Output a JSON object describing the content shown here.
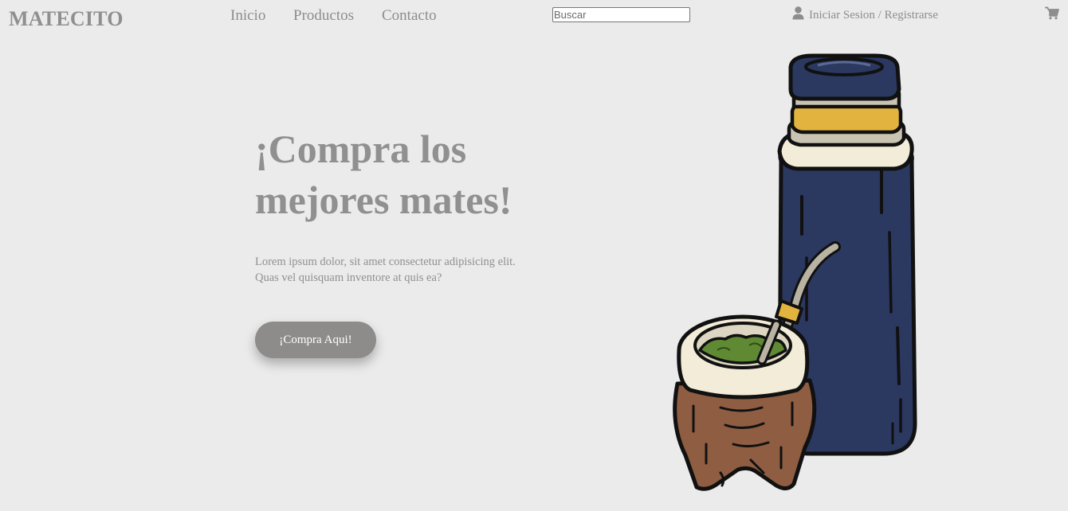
{
  "header": {
    "logo": "MATECITO",
    "nav": [
      {
        "label": "Inicio"
      },
      {
        "label": "Productos"
      },
      {
        "label": "Contacto"
      }
    ],
    "search": {
      "placeholder": "Buscar",
      "value": ""
    },
    "login": {
      "icon": "user-icon",
      "label": "Iniciar Sesion / Registrarse"
    },
    "cart": {
      "icon": "cart-icon"
    }
  },
  "hero": {
    "title_line1": "¡Compra los",
    "title_line2": "mejores mates!",
    "text_line1": "Lorem ipsum dolor, sit amet consectetur adipisicing elit.",
    "text_line2": "Quas vel quisquam inventore at quis ea?",
    "cta_label": "¡Compra Aqui!",
    "illustration": "mate-and-thermos-illustration"
  },
  "colors": {
    "background": "#ebebeb",
    "text": "#8f8f8f",
    "button": "#8e8c8a",
    "thermos": "#2b3860",
    "thermos_ring": "#e3b33f",
    "gourd": "#8e5d42",
    "yerba": "#5f8a33"
  }
}
